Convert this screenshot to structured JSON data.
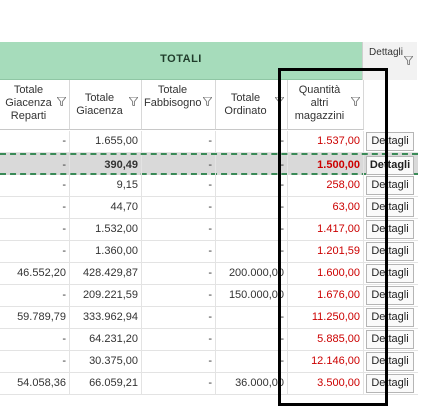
{
  "header": {
    "group_title": "TOTALI",
    "dettagli_header": "Dettagli",
    "columns": [
      "Totale Giacenza Reparti",
      "Totale Giacenza",
      "Totale Fabbisogno",
      "Totale Ordinato",
      "Quantità altri magazzini"
    ]
  },
  "rows": [
    {
      "c1": "-",
      "c2": "1.655,00",
      "c3": "-",
      "c4": "-",
      "c5": "1.537,00",
      "button": "Dettagli"
    },
    {
      "c1": "-",
      "c2": "390,49",
      "c3": "-",
      "c4": "-",
      "c5": "1.500,00",
      "button": "Dettagli",
      "selected": true
    },
    {
      "c1": "-",
      "c2": "9,15",
      "c3": "-",
      "c4": "-",
      "c5": "258,00",
      "button": "Dettagli"
    },
    {
      "c1": "-",
      "c2": "44,70",
      "c3": "-",
      "c4": "-",
      "c5": "63,00",
      "button": "Dettagli"
    },
    {
      "c1": "-",
      "c2": "1.532,00",
      "c3": "-",
      "c4": "-",
      "c5": "1.417,00",
      "button": "Dettagli"
    },
    {
      "c1": "-",
      "c2": "1.360,00",
      "c3": "-",
      "c4": "-",
      "c5": "1.201,59",
      "button": "Dettagli"
    },
    {
      "c1": "46.552,20",
      "c2": "428.429,87",
      "c3": "-",
      "c4": "200.000,00",
      "c5": "1.600,00",
      "button": "Dettagli"
    },
    {
      "c1": "-",
      "c2": "209.221,59",
      "c3": "-",
      "c4": "150.000,00",
      "c5": "1.676,00",
      "button": "Dettagli"
    },
    {
      "c1": "59.789,79",
      "c2": "333.962,94",
      "c3": "-",
      "c4": "-",
      "c5": "11.250,00",
      "button": "Dettagli"
    },
    {
      "c1": "-",
      "c2": "64.231,20",
      "c3": "-",
      "c4": "-",
      "c5": "5.885,00",
      "button": "Dettagli"
    },
    {
      "c1": "-",
      "c2": "30.375,00",
      "c3": "-",
      "c4": "-",
      "c5": "12.146,00",
      "button": "Dettagli"
    },
    {
      "c1": "54.058,36",
      "c2": "66.059,21",
      "c3": "-",
      "c4": "36.000,00",
      "c5": "3.500,00",
      "button": "Dettagli"
    }
  ],
  "colors": {
    "totali_band": "#a6dcbb",
    "negative_red": "#cc0000",
    "highlight_row": "#d9d9d9",
    "annotation": "#000000"
  }
}
